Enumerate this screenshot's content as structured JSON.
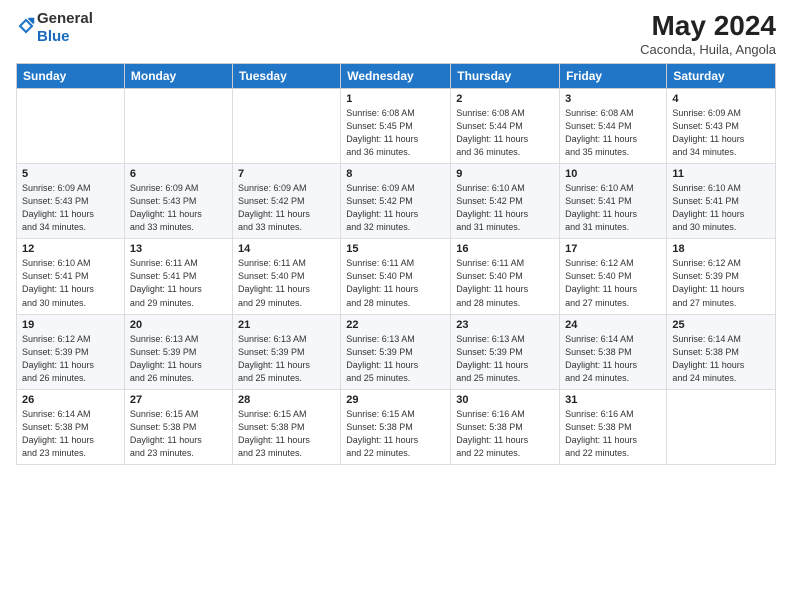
{
  "header": {
    "logo_general": "General",
    "logo_blue": "Blue",
    "month_year": "May 2024",
    "location": "Caconda, Huila, Angola"
  },
  "days_of_week": [
    "Sunday",
    "Monday",
    "Tuesday",
    "Wednesday",
    "Thursday",
    "Friday",
    "Saturday"
  ],
  "weeks": [
    [
      {
        "day": "",
        "info": ""
      },
      {
        "day": "",
        "info": ""
      },
      {
        "day": "",
        "info": ""
      },
      {
        "day": "1",
        "info": "Sunrise: 6:08 AM\nSunset: 5:45 PM\nDaylight: 11 hours\nand 36 minutes."
      },
      {
        "day": "2",
        "info": "Sunrise: 6:08 AM\nSunset: 5:44 PM\nDaylight: 11 hours\nand 36 minutes."
      },
      {
        "day": "3",
        "info": "Sunrise: 6:08 AM\nSunset: 5:44 PM\nDaylight: 11 hours\nand 35 minutes."
      },
      {
        "day": "4",
        "info": "Sunrise: 6:09 AM\nSunset: 5:43 PM\nDaylight: 11 hours\nand 34 minutes."
      }
    ],
    [
      {
        "day": "5",
        "info": "Sunrise: 6:09 AM\nSunset: 5:43 PM\nDaylight: 11 hours\nand 34 minutes."
      },
      {
        "day": "6",
        "info": "Sunrise: 6:09 AM\nSunset: 5:43 PM\nDaylight: 11 hours\nand 33 minutes."
      },
      {
        "day": "7",
        "info": "Sunrise: 6:09 AM\nSunset: 5:42 PM\nDaylight: 11 hours\nand 33 minutes."
      },
      {
        "day": "8",
        "info": "Sunrise: 6:09 AM\nSunset: 5:42 PM\nDaylight: 11 hours\nand 32 minutes."
      },
      {
        "day": "9",
        "info": "Sunrise: 6:10 AM\nSunset: 5:42 PM\nDaylight: 11 hours\nand 31 minutes."
      },
      {
        "day": "10",
        "info": "Sunrise: 6:10 AM\nSunset: 5:41 PM\nDaylight: 11 hours\nand 31 minutes."
      },
      {
        "day": "11",
        "info": "Sunrise: 6:10 AM\nSunset: 5:41 PM\nDaylight: 11 hours\nand 30 minutes."
      }
    ],
    [
      {
        "day": "12",
        "info": "Sunrise: 6:10 AM\nSunset: 5:41 PM\nDaylight: 11 hours\nand 30 minutes."
      },
      {
        "day": "13",
        "info": "Sunrise: 6:11 AM\nSunset: 5:41 PM\nDaylight: 11 hours\nand 29 minutes."
      },
      {
        "day": "14",
        "info": "Sunrise: 6:11 AM\nSunset: 5:40 PM\nDaylight: 11 hours\nand 29 minutes."
      },
      {
        "day": "15",
        "info": "Sunrise: 6:11 AM\nSunset: 5:40 PM\nDaylight: 11 hours\nand 28 minutes."
      },
      {
        "day": "16",
        "info": "Sunrise: 6:11 AM\nSunset: 5:40 PM\nDaylight: 11 hours\nand 28 minutes."
      },
      {
        "day": "17",
        "info": "Sunrise: 6:12 AM\nSunset: 5:40 PM\nDaylight: 11 hours\nand 27 minutes."
      },
      {
        "day": "18",
        "info": "Sunrise: 6:12 AM\nSunset: 5:39 PM\nDaylight: 11 hours\nand 27 minutes."
      }
    ],
    [
      {
        "day": "19",
        "info": "Sunrise: 6:12 AM\nSunset: 5:39 PM\nDaylight: 11 hours\nand 26 minutes."
      },
      {
        "day": "20",
        "info": "Sunrise: 6:13 AM\nSunset: 5:39 PM\nDaylight: 11 hours\nand 26 minutes."
      },
      {
        "day": "21",
        "info": "Sunrise: 6:13 AM\nSunset: 5:39 PM\nDaylight: 11 hours\nand 25 minutes."
      },
      {
        "day": "22",
        "info": "Sunrise: 6:13 AM\nSunset: 5:39 PM\nDaylight: 11 hours\nand 25 minutes."
      },
      {
        "day": "23",
        "info": "Sunrise: 6:13 AM\nSunset: 5:39 PM\nDaylight: 11 hours\nand 25 minutes."
      },
      {
        "day": "24",
        "info": "Sunrise: 6:14 AM\nSunset: 5:38 PM\nDaylight: 11 hours\nand 24 minutes."
      },
      {
        "day": "25",
        "info": "Sunrise: 6:14 AM\nSunset: 5:38 PM\nDaylight: 11 hours\nand 24 minutes."
      }
    ],
    [
      {
        "day": "26",
        "info": "Sunrise: 6:14 AM\nSunset: 5:38 PM\nDaylight: 11 hours\nand 23 minutes."
      },
      {
        "day": "27",
        "info": "Sunrise: 6:15 AM\nSunset: 5:38 PM\nDaylight: 11 hours\nand 23 minutes."
      },
      {
        "day": "28",
        "info": "Sunrise: 6:15 AM\nSunset: 5:38 PM\nDaylight: 11 hours\nand 23 minutes."
      },
      {
        "day": "29",
        "info": "Sunrise: 6:15 AM\nSunset: 5:38 PM\nDaylight: 11 hours\nand 22 minutes."
      },
      {
        "day": "30",
        "info": "Sunrise: 6:16 AM\nSunset: 5:38 PM\nDaylight: 11 hours\nand 22 minutes."
      },
      {
        "day": "31",
        "info": "Sunrise: 6:16 AM\nSunset: 5:38 PM\nDaylight: 11 hours\nand 22 minutes."
      },
      {
        "day": "",
        "info": ""
      }
    ]
  ]
}
